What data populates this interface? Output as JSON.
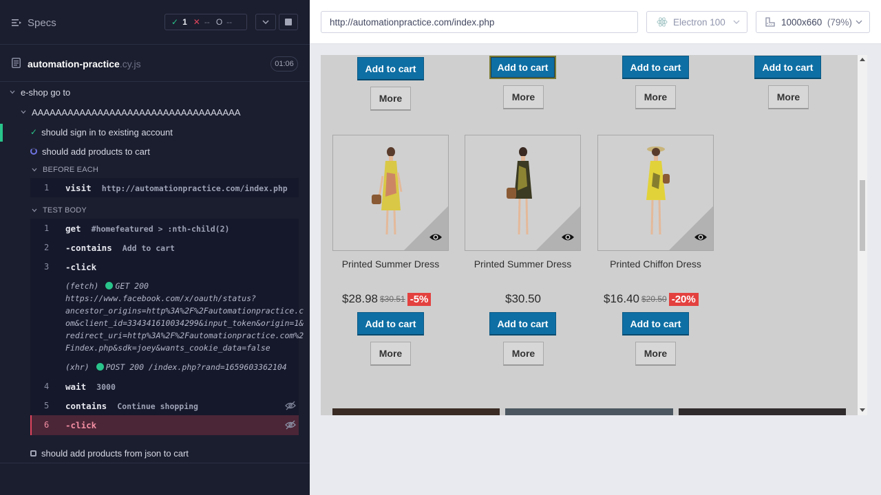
{
  "runner": {
    "specs_label": "Specs",
    "stats": {
      "passed": "1",
      "failed": "--",
      "pending": "--"
    },
    "spec_file": {
      "name": "automation-practice",
      "ext": ".cy.js",
      "duration": "01:06"
    },
    "suite": "e-shop go to",
    "describe": "AAAAAAAAAAAAAAAAAAAAAAAAAAAAAAAAAAA",
    "tests": {
      "signin": "should sign in to existing account",
      "add": "should add products to cart",
      "json": "should add products from json to cart"
    },
    "before_each_label": "BEFORE EACH",
    "before_each": [
      {
        "num": "1",
        "name": "visit",
        "msg": "http://automationpractice.com/index.php"
      }
    ],
    "test_body_label": "TEST BODY",
    "commands": [
      {
        "num": "1",
        "name": "get",
        "msg": "#homefeatured > :nth-child(2)"
      },
      {
        "num": "2",
        "name": "-contains",
        "msg": "Add to cart"
      },
      {
        "num": "3",
        "name": "-click",
        "msg": ""
      },
      {
        "num": "4",
        "name": "wait",
        "msg": "3000"
      },
      {
        "num": "5",
        "name": "contains",
        "msg": "Continue shopping"
      },
      {
        "num": "6",
        "name": "-click",
        "msg": ""
      }
    ],
    "fetch_log": {
      "type": "(fetch)",
      "status": "GET 200",
      "lines": [
        "https://www.facebook.com/x/oauth/status?",
        "ancestor_origins=http%3A%2F%2Fautomationpractice.c",
        "om&client_id=334341610034299&input_token&origin=1&",
        "redirect_uri=http%3A%2F%2Fautomationpractice.com%2",
        "Findex.php&sdk=joey&wants_cookie_data=false"
      ]
    },
    "xhr_log": {
      "type": "(xhr)",
      "status": "POST 200 /index.php?rand=1659603362104"
    }
  },
  "toolbar": {
    "url": "http://automationpractice.com/index.php",
    "browser": "Electron 100",
    "viewport": "1000x660",
    "zoom": "(79%)"
  },
  "aut": {
    "add_to_cart": "Add to cart",
    "more": "More",
    "products": [
      {
        "name": "Printed Summer Dress",
        "price": "$28.98",
        "old_price": "$30.51",
        "discount": "-5%"
      },
      {
        "name": "Printed Summer Dress",
        "price": "$30.50",
        "old_price": "",
        "discount": ""
      },
      {
        "name": "Printed Chiffon Dress",
        "price": "$16.40",
        "old_price": "$20.50",
        "discount": "-20%"
      }
    ]
  }
}
